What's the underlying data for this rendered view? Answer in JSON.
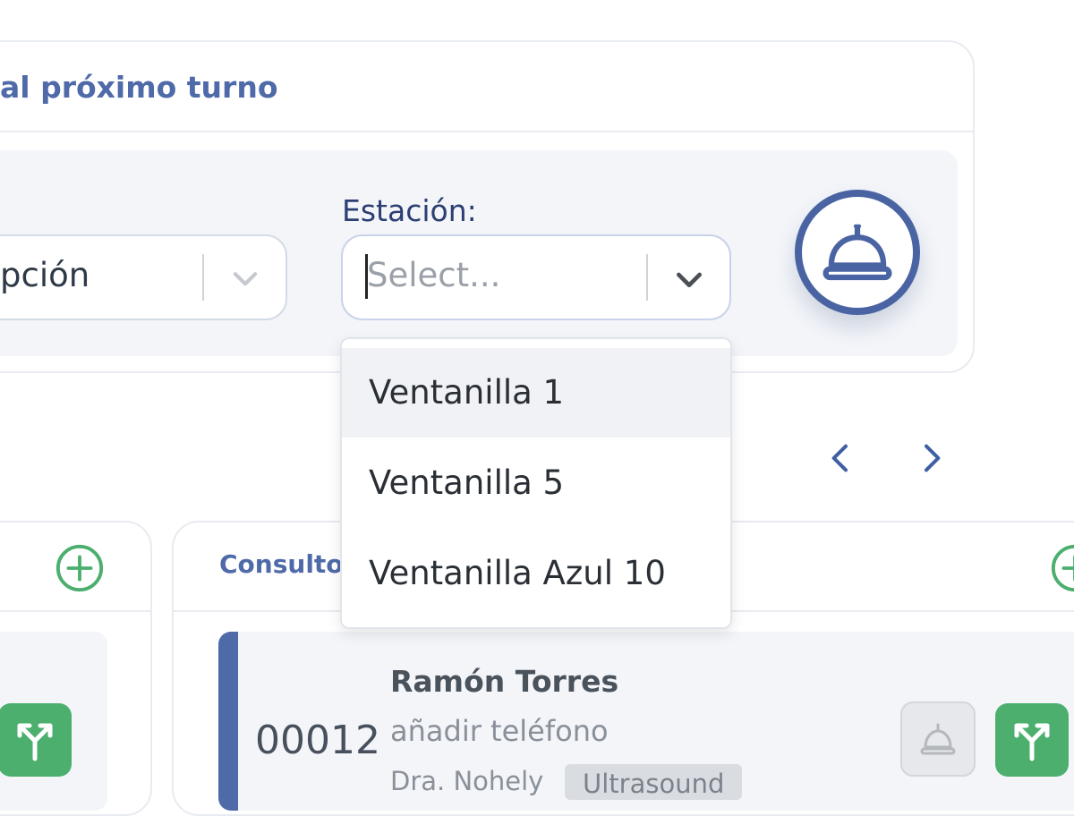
{
  "panel": {
    "title": "al próximo turno",
    "service_select_value": "pción",
    "station_label": "Estación:",
    "station_placeholder": "Select...",
    "station_options": [
      "Ventanilla 1",
      "Ventanilla 5",
      "Ventanilla Azul 10"
    ],
    "highlighted_option": "Ventanilla 1",
    "call_button_icon": "service-bell-icon"
  },
  "pager": {
    "prev_icon": "chevron-left-icon",
    "next_icon": "chevron-right-icon"
  },
  "queue": {
    "column_title": "Consultorio",
    "ticket": {
      "number": "00012",
      "patient_name": "Ramón Torres",
      "phone_link": "añadir teléfono",
      "doctor": "Dra. Nohely",
      "service_badge": "Ultrasound"
    }
  },
  "colors": {
    "accent": "#4a64a3",
    "title_blue": "#4f6aa8",
    "success_green": "#4caf6e",
    "panel_bg": "#f3f5f9"
  }
}
